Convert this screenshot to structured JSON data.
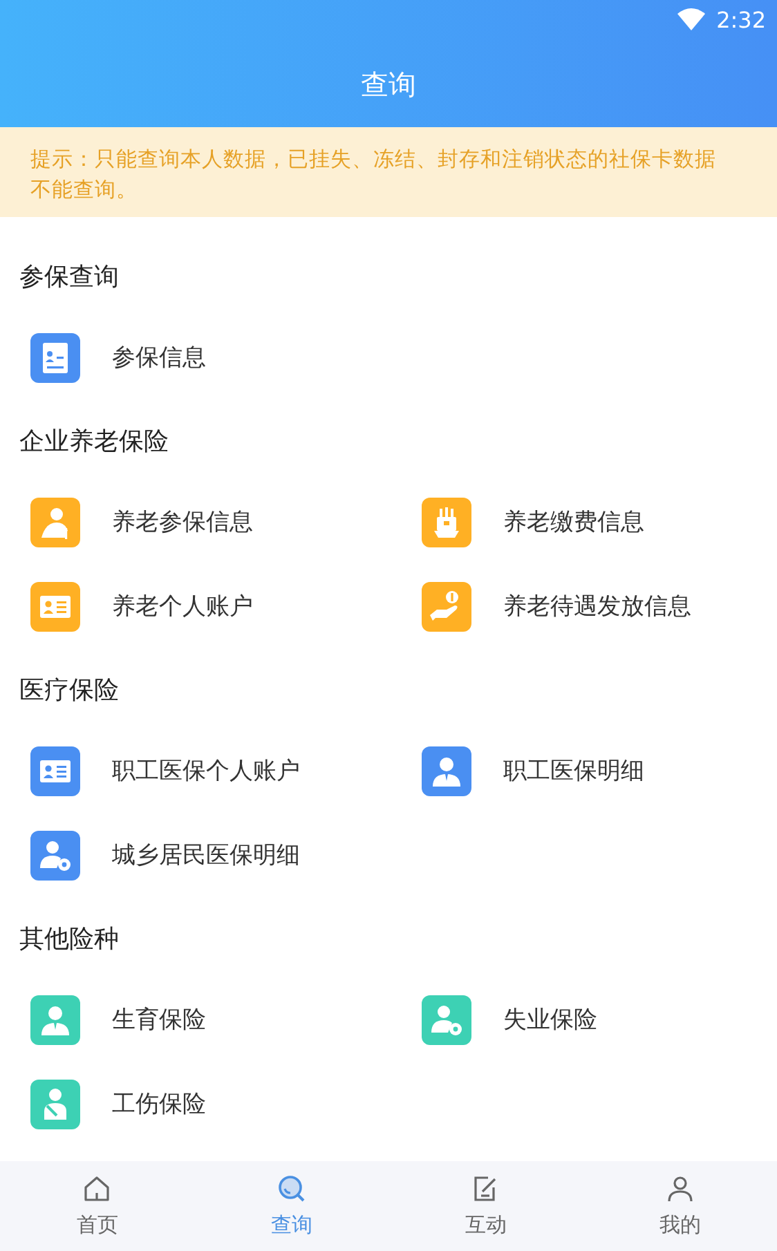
{
  "status_bar": {
    "time": "2:32"
  },
  "header": {
    "title": "查询"
  },
  "notice": {
    "text": "提示：只能查询本人数据，已挂失、冻结、封存和注销状态的社保卡数据不能查询。"
  },
  "sections": [
    {
      "title": "参保查询",
      "items": [
        {
          "label": "参保信息",
          "kind": "document",
          "color": "#4a8ff2"
        }
      ]
    },
    {
      "title": "企业养老保险",
      "items": [
        {
          "label": "养老参保信息",
          "kind": "elder",
          "color": "#ffb024"
        },
        {
          "label": "养老缴费信息",
          "kind": "coins",
          "color": "#ffb024"
        },
        {
          "label": "养老个人账户",
          "kind": "card",
          "color": "#ffb024"
        },
        {
          "label": "养老待遇发放信息",
          "kind": "hand",
          "color": "#ffb024"
        }
      ]
    },
    {
      "title": "医疗保险",
      "items": [
        {
          "label": "职工医保个人账户",
          "kind": "card",
          "color": "#4a8ff2"
        },
        {
          "label": "职工医保明细",
          "kind": "person",
          "color": "#4a8ff2"
        },
        {
          "label": "城乡居民医保明细",
          "kind": "people-gear",
          "color": "#4a8ff2"
        }
      ]
    },
    {
      "title": "其他险种",
      "items": [
        {
          "label": "生育保险",
          "kind": "person",
          "color": "#3dd1b4"
        },
        {
          "label": "失业保险",
          "kind": "people-gear",
          "color": "#3dd1b4"
        },
        {
          "label": "工伤保险",
          "kind": "injured",
          "color": "#3dd1b4"
        }
      ]
    }
  ],
  "tabs": [
    {
      "label": "首页",
      "kind": "home",
      "selected": false
    },
    {
      "label": "查询",
      "kind": "search",
      "selected": true
    },
    {
      "label": "互动",
      "kind": "edit",
      "selected": false
    },
    {
      "label": "我的",
      "kind": "user",
      "selected": false
    }
  ]
}
